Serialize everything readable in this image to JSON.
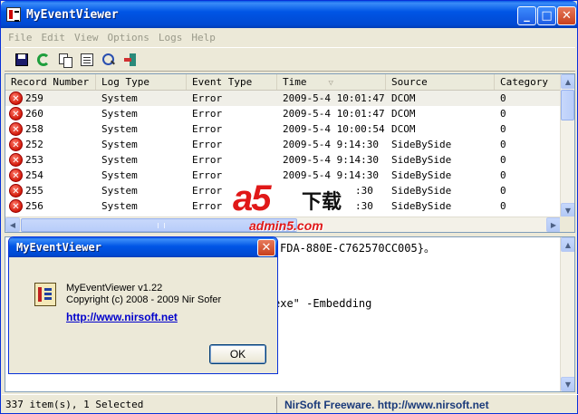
{
  "window": {
    "title": "MyEventViewer",
    "minimize": "_",
    "maximize": "□",
    "close": "✕"
  },
  "menu": [
    "File",
    "Edit",
    "View",
    "Options",
    "Logs",
    "Help"
  ],
  "toolbar": [
    "save-icon",
    "refresh-icon",
    "copy-icon",
    "properties-icon",
    "find-icon",
    "exit-icon"
  ],
  "table": {
    "columns": [
      "Record Number",
      "Log Type",
      "Event Type",
      "Time",
      "Source",
      "Category"
    ],
    "sorted_column_indicator": "▽",
    "rows": [
      {
        "record": "259",
        "log": "System",
        "event": "Error",
        "time": "2009-5-4 10:01:47",
        "source": "DCOM",
        "category": "0",
        "selected": true
      },
      {
        "record": "260",
        "log": "System",
        "event": "Error",
        "time": "2009-5-4 10:01:47",
        "source": "DCOM",
        "category": "0"
      },
      {
        "record": "258",
        "log": "System",
        "event": "Error",
        "time": "2009-5-4 10:00:54",
        "source": "DCOM",
        "category": "0"
      },
      {
        "record": "252",
        "log": "System",
        "event": "Error",
        "time": "2009-5-4 9:14:30",
        "source": "SideBySide",
        "category": "0"
      },
      {
        "record": "253",
        "log": "System",
        "event": "Error",
        "time": "2009-5-4 9:14:30",
        "source": "SideBySide",
        "category": "0"
      },
      {
        "record": "254",
        "log": "System",
        "event": "Error",
        "time": "2009-5-4 9:14:30",
        "source": "SideBySide",
        "category": "0"
      },
      {
        "record": "255",
        "log": "System",
        "event": "Error",
        "time": ":30",
        "source": "SideBySide",
        "category": "0"
      },
      {
        "record": "256",
        "log": "System",
        "event": "Error",
        "time": ":30",
        "source": "SideBySide",
        "category": "0"
      }
    ]
  },
  "detail": {
    "line1": "FDA-880E-C762570CC005}。",
    "line2": "exe\" -Embedding"
  },
  "status": {
    "count": "337 item(s), 1 Selected",
    "credit": "NirSoft Freeware.  http://www.nirsoft.net"
  },
  "watermark": {
    "main": "a5",
    "chinese": "下载",
    "sub": "admin5.com"
  },
  "dialog": {
    "title": "MyEventViewer",
    "close": "✕",
    "version": "MyEventViewer v1.22",
    "copyright": "Copyright (c) 2008 - 2009 Nir Sofer",
    "link": "http://www.nirsoft.net",
    "ok": "OK"
  },
  "scroll": {
    "up": "▲",
    "down": "▼",
    "left": "◀",
    "right": "▶"
  },
  "error_glyph": "✕"
}
